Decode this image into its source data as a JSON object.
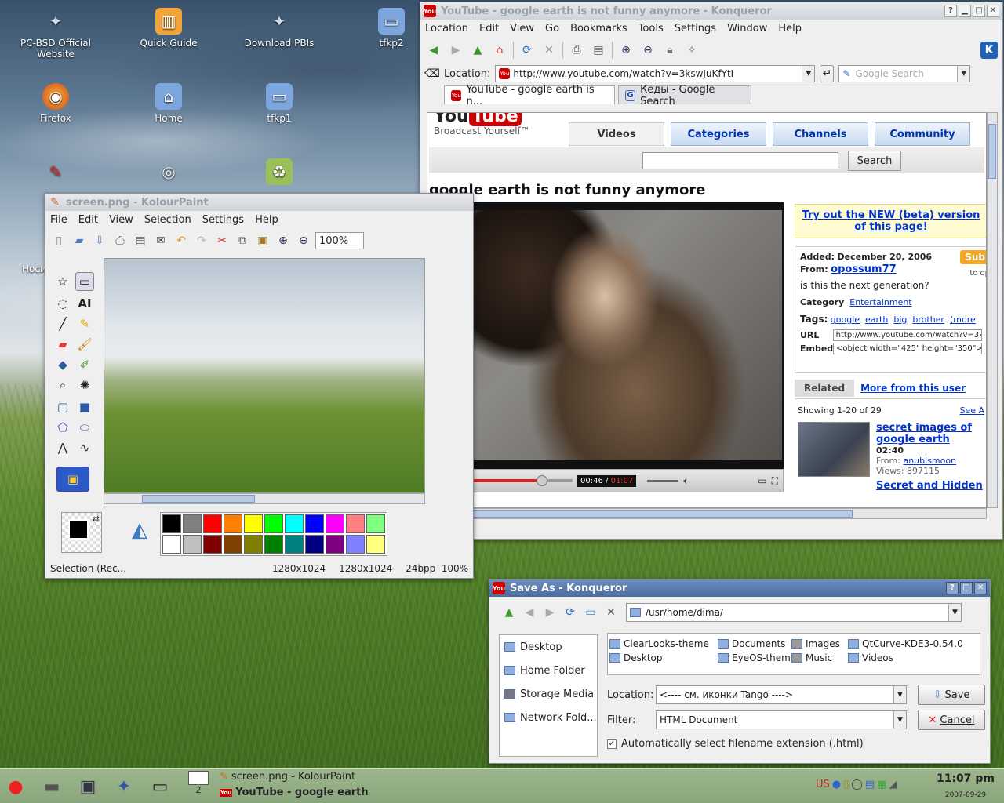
{
  "desktop": {
    "icons": [
      {
        "label": "PC-BSD Official Website",
        "glyph": "✦",
        "color": "#4a7fc0"
      },
      {
        "label": "Quick Guide",
        "glyph": "▥",
        "color": "#e98a1a"
      },
      {
        "label": "Download PBIs",
        "glyph": "✦",
        "color": "#4a7fc0"
      },
      {
        "label": "tfkp2",
        "glyph": "▭",
        "color": "#6f9bd6"
      },
      {
        "label": "Firefox",
        "glyph": "◉",
        "color": "#e0601a"
      },
      {
        "label": "Home",
        "glyph": "⌂",
        "color": "#6f9bd6"
      },
      {
        "label": "tfkp1",
        "glyph": "▭",
        "color": "#6f9bd6"
      },
      {
        "label": "KPaint",
        "glyph": "✎",
        "color": "#c0302a"
      },
      {
        "label": "disc",
        "glyph": "◎",
        "color": "#cccccc"
      },
      {
        "label": "Trash",
        "glyph": "♻",
        "color": "#7aa040"
      },
      {
        "label": "Носи",
        "glyph": "",
        "color": "transparent"
      }
    ]
  },
  "konqueror": {
    "title": "YouTube - google earth is not funny anymore - Konqueror",
    "menu": [
      "Location",
      "Edit",
      "View",
      "Go",
      "Bookmarks",
      "Tools",
      "Settings",
      "Window",
      "Help"
    ],
    "location_label": "Location:",
    "url": "http://www.youtube.com/watch?v=3kswJuKfYtI",
    "search_placeholder": "Google Search",
    "tabs": [
      "YouTube - google earth is n...",
      "Кеды - Google Search"
    ],
    "page": {
      "tagline": "Broadcast Yourself™",
      "nav": [
        "Videos",
        "Categories",
        "Channels",
        "Community"
      ],
      "search_button": "Search",
      "video_title": "google earth is not funny anymore",
      "time_current": "00:46",
      "time_total": "01:07",
      "promo": "Try out the NEW (beta) version of this page!",
      "added_label": "Added:",
      "added_date": "December 20, 2006",
      "from_label": "From:",
      "from_user": "opossum77",
      "subscribe": "Sub",
      "subscribe_note": "to op",
      "description": "is this the next generation?",
      "category_label": "Category",
      "category": "Entertainment",
      "tags_label": "Tags:",
      "tags": [
        "google",
        "earth",
        "big",
        "brother",
        "(more"
      ],
      "url_label": "URL",
      "url_value": "http://www.youtube.com/watch?v=3k",
      "embed_label": "Embed",
      "embed_value": "<object width=\"425\" height=\"350\">",
      "related_tab": "Related",
      "more_tab": "More from this user",
      "showing": "Showing 1-20 of 29",
      "see_all": "See A",
      "related_title": "secret images of google earth",
      "related_duration": "02:40",
      "related_from_label": "From:",
      "related_from": "anubismoon",
      "related_views": "Views: 897115",
      "next_title": "Secret and Hidden"
    }
  },
  "kolourpaint": {
    "title": "screen.png - KolourPaint",
    "menu": [
      "File",
      "Edit",
      "View",
      "Selection",
      "Settings",
      "Help"
    ],
    "zoom": "100%",
    "palette": [
      "#000000",
      "#808080",
      "#ff0000",
      "#ff8000",
      "#ffff00",
      "#00ff00",
      "#00ffff",
      "#0000ff",
      "#ff00ff",
      "#ff8080",
      "#80ff80",
      "#ffffff",
      "#c0c0c0",
      "#800000",
      "#804000",
      "#808000",
      "#008000",
      "#008080",
      "#000080",
      "#800080",
      "#8080ff",
      "#ffff80"
    ],
    "status_tool": "Selection (Rec...",
    "status_size1": "1280x1024",
    "status_size2": "1280x1024",
    "status_bpp": "24bpp",
    "status_zoom": "100%"
  },
  "save_dialog": {
    "title": "Save As - Konqueror",
    "path": "/usr/home/dima/",
    "places": [
      "Desktop",
      "Home Folder",
      "Storage Media",
      "Network Fold..."
    ],
    "files": [
      "ClearLooks-theme",
      "Documents",
      "Images",
      "QtCurve-KDE3-0.54.0",
      "Desktop",
      "EyeOS-theme",
      "Music",
      "Videos"
    ],
    "location_label": "Location:",
    "location_value": "<---- см.  иконки Tango ---->",
    "filter_label": "Filter:",
    "filter_value": "HTML Document",
    "save": "Save",
    "cancel": "Cancel",
    "auto_ext": "Automatically select filename extension (.html)"
  },
  "taskbar": {
    "desk_num": "2",
    "task1": "screen.png - KolourPaint",
    "task2": "YouTube - google earth",
    "time": "11:07 pm",
    "date": "2007-09-29"
  }
}
